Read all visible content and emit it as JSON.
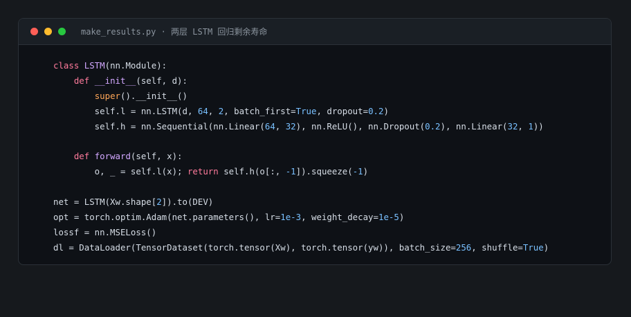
{
  "window": {
    "title": "make_results.py · 两层 LSTM 回归剩余寿命",
    "colors": {
      "close": "#ff5f57",
      "minimize": "#febc2e",
      "zoom": "#28c840"
    }
  },
  "code_lines": [
    [
      [
        "kw",
        "class "
      ],
      [
        "fn",
        "LSTM"
      ],
      [
        "pl",
        "(nn.Module):"
      ]
    ],
    [
      [
        "pl",
        "    "
      ],
      [
        "kw",
        "def "
      ],
      [
        "fn",
        "__init__"
      ],
      [
        "pl",
        "(self, d):"
      ]
    ],
    [
      [
        "pl",
        "        "
      ],
      [
        "bi",
        "super"
      ],
      [
        "pl",
        "().__init__()"
      ]
    ],
    [
      [
        "pl",
        "        self.l = nn.LSTM(d, "
      ],
      [
        "nm",
        "64"
      ],
      [
        "pl",
        ", "
      ],
      [
        "nm",
        "2"
      ],
      [
        "pl",
        ", batch_first="
      ],
      [
        "nm",
        "True"
      ],
      [
        "pl",
        ", dropout="
      ],
      [
        "nm",
        "0.2"
      ],
      [
        "pl",
        ")"
      ]
    ],
    [
      [
        "pl",
        "        self.h = nn.Sequential(nn.Linear("
      ],
      [
        "nm",
        "64"
      ],
      [
        "pl",
        ", "
      ],
      [
        "nm",
        "32"
      ],
      [
        "pl",
        "), nn.ReLU(), nn.Dropout("
      ],
      [
        "nm",
        "0.2"
      ],
      [
        "pl",
        "), nn.Linear("
      ],
      [
        "nm",
        "32"
      ],
      [
        "pl",
        ", "
      ],
      [
        "nm",
        "1"
      ],
      [
        "pl",
        "))"
      ]
    ],
    [],
    [
      [
        "pl",
        "    "
      ],
      [
        "kw",
        "def "
      ],
      [
        "fn",
        "forward"
      ],
      [
        "pl",
        "(self, x):"
      ]
    ],
    [
      [
        "pl",
        "        o, _ = self.l(x); "
      ],
      [
        "kw",
        "return"
      ],
      [
        "pl",
        " self.h(o[:, "
      ],
      [
        "nm",
        "-1"
      ],
      [
        "pl",
        "]).squeeze("
      ],
      [
        "nm",
        "-1"
      ],
      [
        "pl",
        ")"
      ]
    ],
    [],
    [
      [
        "pl",
        "net = LSTM(Xw.shape["
      ],
      [
        "nm",
        "2"
      ],
      [
        "pl",
        "]).to(DEV)"
      ]
    ],
    [
      [
        "pl",
        "opt = torch.optim.Adam(net.parameters(), lr="
      ],
      [
        "nm",
        "1e-3"
      ],
      [
        "pl",
        ", weight_decay="
      ],
      [
        "nm",
        "1e-5"
      ],
      [
        "pl",
        ")"
      ]
    ],
    [
      [
        "pl",
        "lossf = nn.MSELoss()"
      ]
    ],
    [
      [
        "pl",
        "dl = DataLoader(TensorDataset(torch.tensor(Xw), torch.tensor(yw)), batch_size="
      ],
      [
        "nm",
        "256"
      ],
      [
        "pl",
        ", shuffle="
      ],
      [
        "nm",
        "True"
      ],
      [
        "pl",
        ")"
      ]
    ]
  ]
}
